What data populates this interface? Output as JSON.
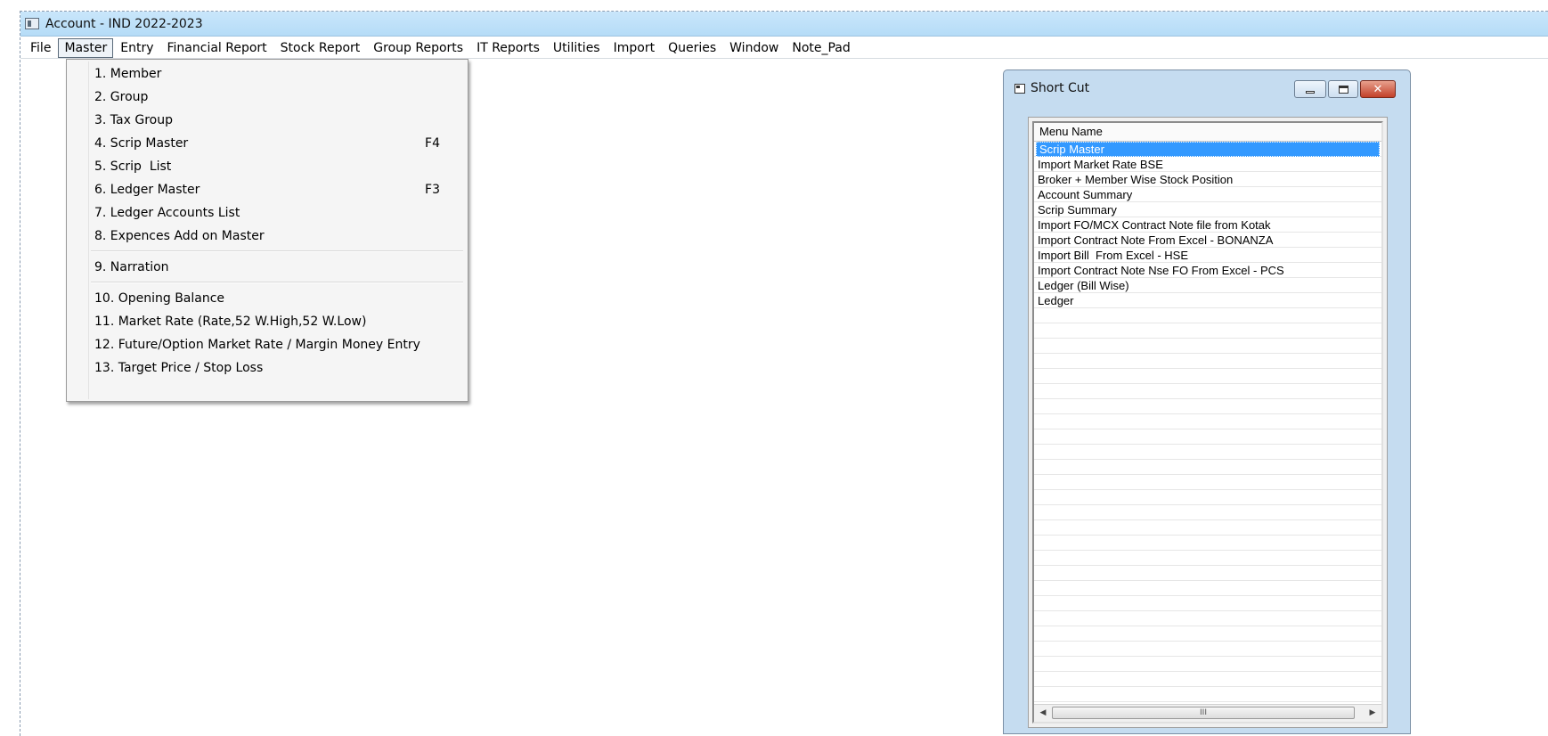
{
  "window": {
    "title": "Account - IND 2022-2023"
  },
  "menubar": {
    "items": [
      "File",
      "Master",
      "Entry",
      "Financial Report",
      "Stock Report",
      "Group Reports",
      "IT Reports",
      "Utilities",
      "Import",
      "Queries",
      "Window",
      "Note_Pad"
    ],
    "active": "Master"
  },
  "master_menu": {
    "items": [
      {
        "label": "1. Member",
        "shortcut": ""
      },
      {
        "label": "2. Group",
        "shortcut": ""
      },
      {
        "label": "3. Tax Group",
        "shortcut": ""
      },
      {
        "label": "4. Scrip Master",
        "shortcut": "F4"
      },
      {
        "label": "5. Scrip  List",
        "shortcut": ""
      },
      {
        "label": "6. Ledger Master",
        "shortcut": "F3"
      },
      {
        "label": "7. Ledger Accounts List",
        "shortcut": ""
      },
      {
        "label": "8. Expences Add on Master",
        "shortcut": ""
      },
      {
        "label": "9. Narration",
        "shortcut": ""
      },
      {
        "label": "10. Opening Balance",
        "shortcut": ""
      },
      {
        "label": "11. Market Rate (Rate,52 W.High,52 W.Low)",
        "shortcut": ""
      },
      {
        "label": "12. Future/Option Market Rate / Margin Money Entry",
        "shortcut": ""
      },
      {
        "label": "13. Target Price / Stop Loss",
        "shortcut": ""
      }
    ]
  },
  "shortcut_window": {
    "title": "Short Cut",
    "column_header": "Menu Name",
    "rows": [
      "Scrip Master",
      "Import Market Rate BSE",
      "Broker + Member Wise Stock Position",
      "Account Summary",
      "Scrip Summary",
      "Import FO/MCX Contract Note file from Kotak",
      "Import Contract Note From Excel - BONANZA",
      "Import Bill  From Excel - HSE",
      "Import Contract Note Nse FO From Excel - PCS",
      "Ledger (Bill Wise)",
      "Ledger"
    ],
    "selected_index": 0,
    "scroll_grip": "III"
  }
}
